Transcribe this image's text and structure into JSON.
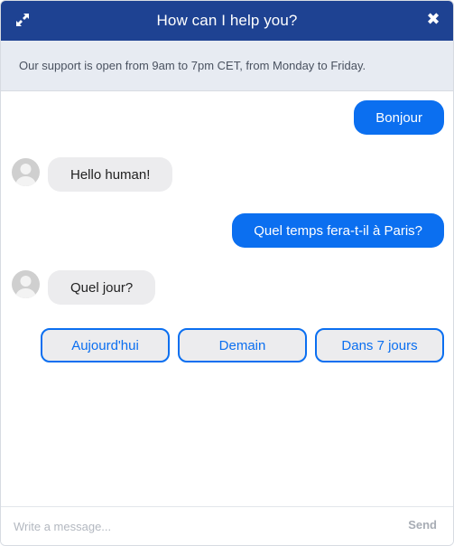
{
  "header": {
    "title": "How can I help you?",
    "expand_icon": "expand-arrows-icon",
    "close_icon": "close-icon",
    "close_glyph": "✖",
    "background": "#1e4292"
  },
  "notice": {
    "text": "Our support is open from 9am to 7pm CET, from Monday to Friday."
  },
  "messages": [
    {
      "from": "user",
      "text": "Bonjour"
    },
    {
      "from": "bot",
      "text": "Hello human!"
    },
    {
      "from": "user",
      "text": "Quel temps fera-t-il à Paris?"
    },
    {
      "from": "bot",
      "text": "Quel jour?"
    }
  ],
  "quick_replies": [
    "Aujourd'hui",
    "Demain",
    "Dans 7 jours"
  ],
  "composer": {
    "placeholder": "Write a message...",
    "send_label": "Send"
  },
  "colors": {
    "user_bubble": "#0b6ff0",
    "bot_bubble": "#ececee",
    "notice_bg": "#e7ebf2"
  }
}
